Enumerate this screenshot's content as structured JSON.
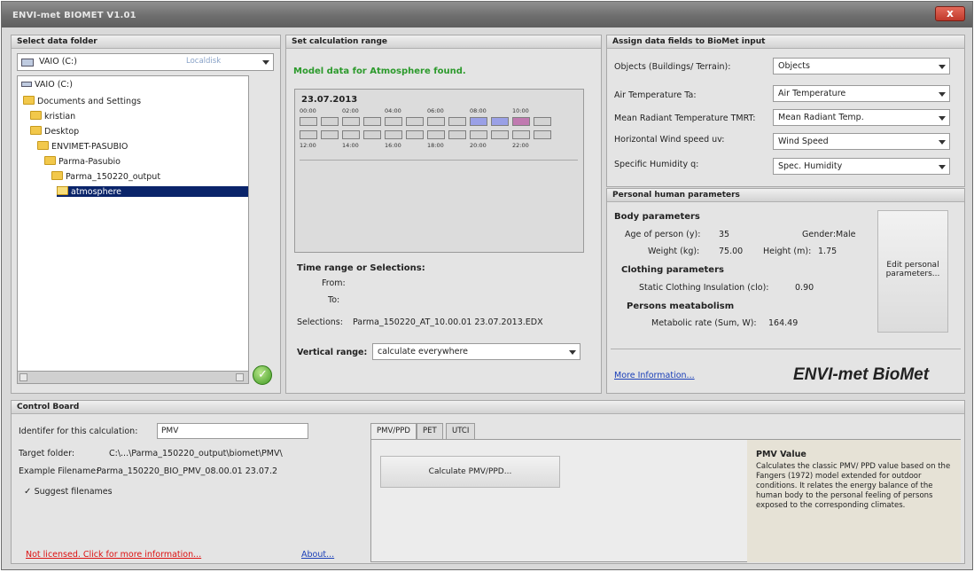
{
  "window": {
    "title": "ENVI-met BIOMET V1.01",
    "close_label": "x"
  },
  "data_folder": {
    "header": "Select data folder",
    "drive": "VAIO (C:)",
    "drive_type": "Localdisk",
    "tree": [
      "VAIO (C:)",
      "Documents and Settings",
      "kristian",
      "Desktop",
      "ENVIMET-PASUBIO",
      "Parma-Pasubio",
      "Parma_150220_output",
      "atmosphere"
    ]
  },
  "calc_range": {
    "header": "Set calculation range",
    "status": "Model data for Atmosphere found.",
    "date": "23.07.2013",
    "top_ticks": [
      "00:00",
      "02:00",
      "04:00",
      "06:00",
      "08:00",
      "10:00"
    ],
    "bottom_ticks": [
      "12:00",
      "14:00",
      "16:00",
      "18:00",
      "20:00",
      "22:00"
    ],
    "time_range_title": "Time range or Selections:",
    "from_label": "From:",
    "to_label": "To:",
    "selections_label": "Selections:",
    "selections_value": "Parma_150220_AT_10.00.01 23.07.2013.EDX",
    "vertical_label": "Vertical range:",
    "vertical_value": "calculate everywhere"
  },
  "assign": {
    "header": "Assign data fields to BioMet input",
    "rows": [
      {
        "label": "Objects (Buildings/ Terrain):",
        "value": "Objects"
      },
      {
        "label": "Air Temperature Ta:",
        "value": "Air Temperature"
      },
      {
        "label": "Mean Radiant Temperature TMRT:",
        "value": "Mean Radiant Temp."
      },
      {
        "label": "Horizontal Wind speed uv:",
        "value": "Wind Speed"
      },
      {
        "label": "Specific Humidity q:",
        "value": "Spec. Humidity"
      }
    ]
  },
  "personal": {
    "header": "Personal human parameters",
    "body_title": "Body parameters",
    "age_label": "Age of person (y):",
    "age_value": "35",
    "gender_label": "Gender:",
    "gender_value": "Male",
    "weight_label": "Weight (kg):",
    "weight_value": "75.00",
    "height_label": "Height (m):",
    "height_value": "1.75",
    "clothing_title": "Clothing parameters",
    "clo_label": "Static Clothing Insulation (clo):",
    "clo_value": "0.90",
    "metab_title": "Persons meatabolism",
    "metab_label": "Metabolic rate (Sum, W):",
    "metab_value": "164.49",
    "edit_button": "Edit personal parameters...",
    "more_info": "More Information...",
    "brand": "ENVI-met  BioMet"
  },
  "control": {
    "header": "Control Board",
    "identifier_label": "Identifer for this calculation:",
    "identifier_value": "PMV",
    "target_label": "Target folder:",
    "target_value": "C:\\...\\Parma_150220_output\\biomet\\PMV\\",
    "example_label": "Example Filename:",
    "example_value": "Parma_150220_BIO_PMV_08.00.01 23.07.2",
    "suggest_label": "Suggest filenames",
    "not_licensed": "Not licensed. Click for more information...",
    "about": "About...",
    "tabs": [
      "PMV/PPD",
      "PET",
      "UTCI"
    ],
    "calc_button": "Calculate PMV/PPD...",
    "info_title": "PMV Value",
    "info_text": "Calculates the classic PMV/ PPD value based on the Fangers (1972) model extended for outdoor conditions. It relates the energy balance of the human body to the personal feeling of persons exposed to the corresponding climates."
  }
}
